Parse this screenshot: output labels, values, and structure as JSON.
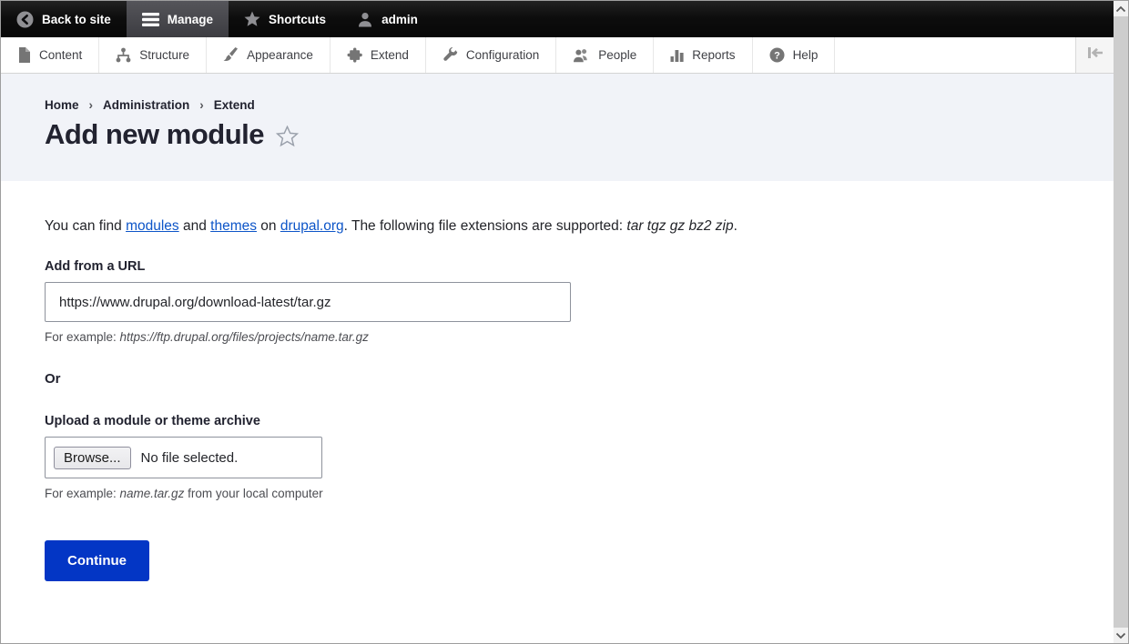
{
  "admin_toolbar": {
    "back_to_site": "Back to site",
    "manage": "Manage",
    "shortcuts": "Shortcuts",
    "user": "admin"
  },
  "admin_menu": {
    "items": [
      "Content",
      "Structure",
      "Appearance",
      "Extend",
      "Configuration",
      "People",
      "Reports",
      "Help"
    ]
  },
  "icons": {
    "back-to-site": "circle-left-chevron",
    "manage": "hamburger",
    "shortcuts": "star",
    "admin-user": "person",
    "content": "document",
    "structure": "sitemap",
    "appearance": "paintbrush",
    "extend": "puzzle-piece",
    "configuration": "wrench",
    "people": "two-users",
    "reports": "bar-chart",
    "help": "question-circle",
    "tray-toggle": "bar-left-arrow",
    "title-shortcut": "star-outline"
  },
  "breadcrumb": {
    "items": [
      "Home",
      "Administration",
      "Extend"
    ],
    "separator": "›"
  },
  "page": {
    "title": "Add new module"
  },
  "intro": {
    "part1": "You can find ",
    "link_modules": "modules",
    "part2": " and ",
    "link_themes": "themes",
    "part3": " on ",
    "link_drupal": "drupal.org",
    "part4": ". The following file extensions are supported: ",
    "extensions": "tar tgz gz bz2 zip",
    "part5": "."
  },
  "url_field": {
    "label": "Add from a URL",
    "value": "https://www.drupal.org/download-latest/tar.gz",
    "description_prefix": "For example: ",
    "description_example": "https://ftp.drupal.org/files/projects/name.tar.gz"
  },
  "or_separator": "Or",
  "upload_field": {
    "label": "Upload a module or theme archive",
    "browse_label": "Browse...",
    "no_file_text": "No file selected.",
    "description_prefix": "For example: ",
    "description_example": "name.tar.gz",
    "description_suffix": " from your local computer"
  },
  "continue_label": "Continue",
  "colors": {
    "primary_button": "#0336c5",
    "link": "#0d55c8",
    "header_band": "#f1f3f8",
    "toolbar_black": "#0d0d0d",
    "active_tab_gray": "#47474c"
  }
}
